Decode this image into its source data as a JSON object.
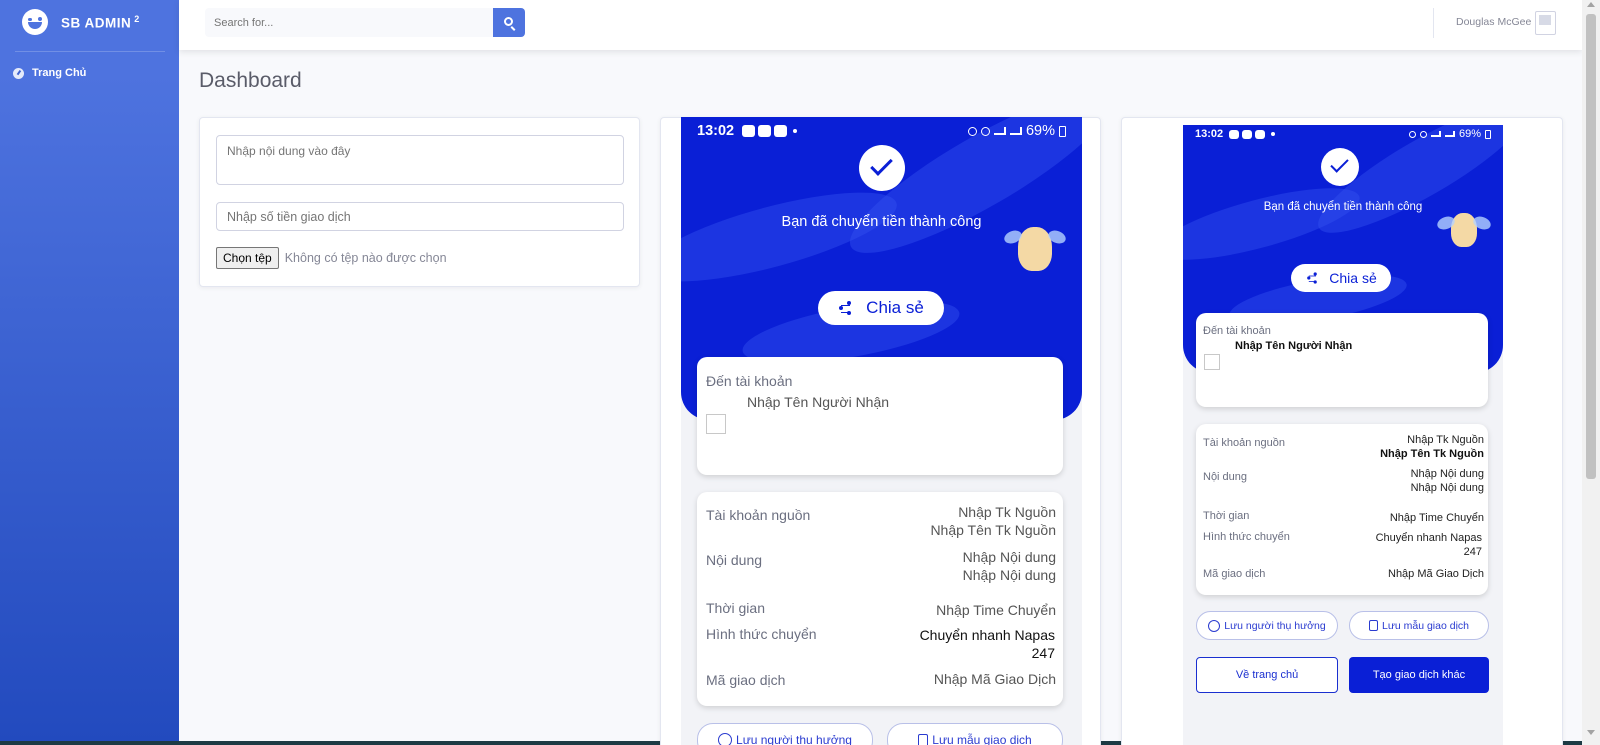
{
  "brand": {
    "name": "SB ADMIN",
    "version": "2"
  },
  "sidebar": {
    "items": [
      {
        "label": "Trang Chủ",
        "icon": "tachometer-icon"
      }
    ]
  },
  "topbar": {
    "search_placeholder": "Search for...",
    "user_name": "Douglas McGee"
  },
  "page": {
    "title": "Dashboard"
  },
  "form": {
    "content_placeholder": "Nhập nội dung vào đây",
    "amount_placeholder": "Nhập số tiền giao dịch",
    "file_button": "Chọn tệp",
    "file_status": "Không có tệp nào được chọn"
  },
  "receipt": {
    "status_time": "13:02",
    "status_battery": "69%",
    "success_message": "Bạn đã chuyển tiền thành công",
    "share_label": "Chia sẻ",
    "to_account_label": "Đến tài khoản",
    "recipient_name": "Nhập Tên Người Nhận",
    "source_label": "Tài khoản nguồn",
    "source_account": "Nhập Tk Nguồn",
    "source_name": "Nhập Tên Tk Nguồn",
    "content_label": "Nội dung",
    "content_line1": "Nhập Nội dung",
    "content_line2": "Nhập Nội dung",
    "time_label": "Thời gian",
    "time_value": "Nhập Time Chuyển",
    "method_label": "Hình thức chuyển",
    "method_value_1": "Chuyển nhanh Napas",
    "method_value_2": "247",
    "txn_label": "Mã giao dịch",
    "txn_value": "Nhập Mã Giao Dịch",
    "save_recipient": "Lưu người thụ hưởng",
    "save_template": "Lưu mẫu giao dịch",
    "home_button": "Về trang chủ",
    "new_txn_button": "Tạo giao dịch khác"
  },
  "colors": {
    "primary": "#4e73df",
    "app_blue": "#0a1fd6"
  }
}
